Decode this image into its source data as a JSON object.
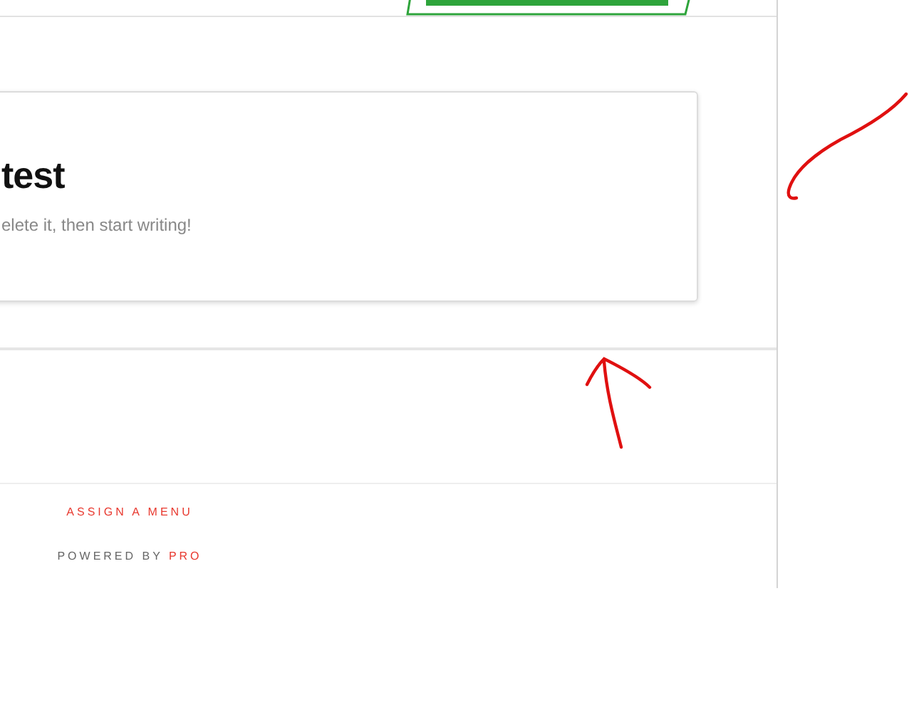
{
  "post_card": {
    "title": "test",
    "body": "elete it, then start writing!"
  },
  "footer": {
    "menu_link": "ASSIGN A MENU",
    "powered_by": "POWERED BY",
    "powered_link": "PRO"
  }
}
